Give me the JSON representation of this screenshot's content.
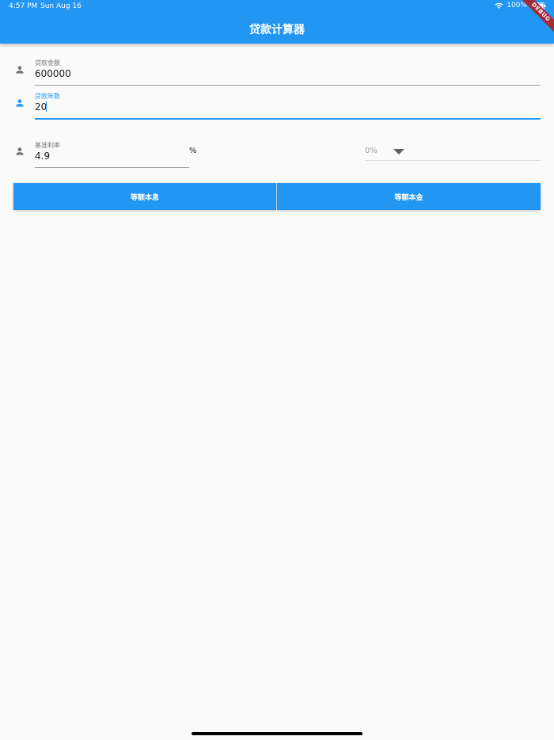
{
  "status_bar": {
    "time": "4:57 PM",
    "date": "Sun Aug 16",
    "battery": "100%",
    "icons": [
      "wifi-icon",
      "battery-icon"
    ]
  },
  "app_bar": {
    "title": "贷款计算器"
  },
  "debug_banner": "DEBUG",
  "form": {
    "loan_amount": {
      "label": "贷款金额",
      "value": "600000",
      "icon": "person-icon"
    },
    "loan_years": {
      "label": "贷款年数",
      "value": "20",
      "icon": "person-icon",
      "focused": true
    },
    "base_rate": {
      "label": "基准利率",
      "value": "4.9",
      "suffix": "%",
      "icon": "person-icon"
    },
    "rate_adjust": {
      "selected": "0%"
    }
  },
  "buttons": {
    "equal_installment": "等额本息",
    "equal_principal": "等额本金"
  },
  "colors": {
    "primary": "#2196f3",
    "background": "#fafafa",
    "debug": "#a52a3a"
  }
}
